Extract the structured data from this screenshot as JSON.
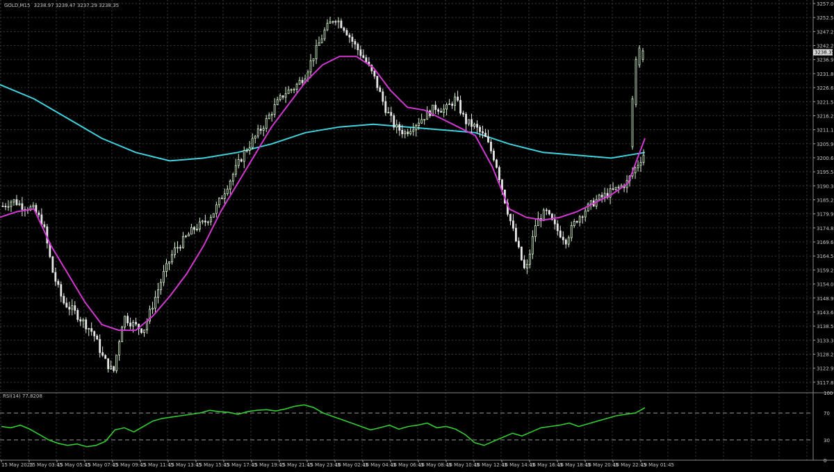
{
  "header": {
    "symbol": "GOLD,M15",
    "ohlc": "3238.97 3239.47 3237.29 3238.35"
  },
  "colors": {
    "background": "#000000",
    "grid": "#3a3a3a",
    "bull": "#d9f7d0",
    "bear": "#e8e8e8",
    "ma_fast": "#d238d2",
    "ma_slow": "#3fd3e0",
    "rsi_line": "#32cd32",
    "current_price_tag": "#dcdcdc"
  },
  "rsi_panel": {
    "label": "RSI(14) 77.8208",
    "levels": [
      "100",
      "70",
      "30",
      "0"
    ]
  },
  "current_price_label": "3238.35",
  "chart_data": {
    "type": "candlestick",
    "timeframe": "M15",
    "y_tick_labels": [
      "3257.00",
      "3252.55",
      "3247.20",
      "3242.20",
      "3236.95",
      "3231.85",
      "3226.60",
      "3221.50",
      "3216.25",
      "3211.15",
      "3205.90",
      "3200.65",
      "3195.55",
      "3190.30",
      "3185.20",
      "3179.95",
      "3174.85",
      "3169.60",
      "3164.50",
      "3159.25",
      "3154.00",
      "3148.90",
      "3143.65",
      "3138.55",
      "3133.30",
      "3128.20",
      "3122.95",
      "3117.85"
    ],
    "x_tick_labels": [
      "15 May 2025",
      "15 May 03:45",
      "15 May 05:45",
      "15 May 07:45",
      "15 May 09:45",
      "15 May 11:45",
      "15 May 13:45",
      "15 May 15:45",
      "15 May 17:45",
      "15 May 19:45",
      "15 May 21:45",
      "15 May 23:45",
      "16 May 02:45",
      "16 May 04:45",
      "16 May 06:45",
      "16 May 08:45",
      "16 May 10:45",
      "16 May 12:45",
      "16 May 14:45",
      "16 May 16:45",
      "16 May 18:45",
      "16 May 20:45",
      "16 May 22:45",
      "19 May 01:45"
    ],
    "ylim": [
      3117.85,
      3257.0
    ],
    "price_series": {
      "name": "close",
      "x": [
        0,
        4,
        8,
        12,
        16,
        20,
        24,
        28,
        32,
        36,
        40,
        44,
        48,
        52,
        56,
        60,
        64,
        68,
        72,
        76,
        80,
        84,
        88,
        92,
        96,
        100,
        104,
        108,
        112,
        116,
        120,
        124,
        128,
        132,
        136,
        140,
        144,
        148,
        152,
        156,
        160,
        164,
        168,
        172,
        176,
        180,
        184,
        188,
        192,
        196,
        200,
        204,
        208,
        212,
        216,
        220,
        224,
        228
      ],
      "y": [
        3184,
        3186,
        3184,
        3183,
        3178,
        3160,
        3150,
        3147,
        3143,
        3139,
        3130,
        3125,
        3145,
        3142,
        3140,
        3150,
        3160,
        3168,
        3172,
        3176,
        3178,
        3182,
        3189,
        3196,
        3203,
        3208,
        3213,
        3219,
        3224,
        3226,
        3230,
        3238,
        3246,
        3251,
        3247,
        3241,
        3236,
        3229,
        3219,
        3212,
        3210,
        3213,
        3216,
        3219,
        3218,
        3222,
        3214,
        3212,
        3208,
        3200,
        3185,
        3172,
        3160,
        3178,
        3182,
        3176,
        3172,
        3179
      ],
      "x_end_extra": [
        232,
        236,
        240,
        244,
        248,
        252,
        256
      ],
      "y_end_extra": [
        3183,
        3186,
        3188,
        3190,
        3192,
        3198,
        3204
      ]
    },
    "last_price": 3238.35,
    "ma_fast_points": [
      3180,
      3182,
      3183,
      3170,
      3160,
      3150,
      3142,
      3140,
      3140,
      3145,
      3152,
      3160,
      3170,
      3182,
      3192,
      3202,
      3212,
      3220,
      3228,
      3234,
      3237,
      3237,
      3233,
      3225,
      3219,
      3218,
      3215,
      3212,
      3209,
      3198,
      3183,
      3180,
      3179,
      3180,
      3182,
      3185,
      3188,
      3192,
      3208
    ],
    "ma_slow_points": [
      3227,
      3222,
      3215,
      3208,
      3203,
      3200,
      3201,
      3203,
      3206,
      3210,
      3212,
      3213,
      3212,
      3211,
      3210,
      3206,
      3203,
      3202,
      3201,
      3203
    ],
    "rsi_ylim": [
      0,
      100
    ],
    "rsi_points": [
      50,
      48,
      52,
      46,
      38,
      30,
      25,
      22,
      24,
      20,
      22,
      28,
      45,
      48,
      42,
      50,
      58,
      62,
      64,
      66,
      68,
      70,
      74,
      72,
      71,
      68,
      72,
      74,
      75,
      73,
      76,
      80,
      82,
      78,
      70,
      65,
      60,
      55,
      50,
      45,
      48,
      52,
      46,
      50,
      52,
      55,
      48,
      50,
      46,
      38,
      26,
      22,
      28,
      34,
      40,
      36,
      42,
      48,
      50,
      52,
      55,
      50,
      54,
      58,
      62,
      66,
      68,
      70,
      77.8
    ]
  }
}
